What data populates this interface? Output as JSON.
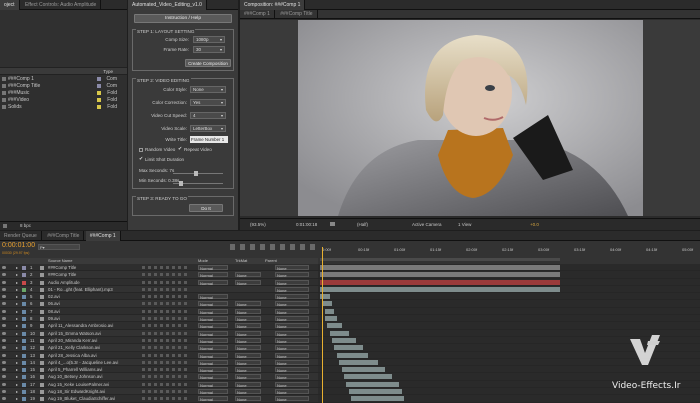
{
  "project_panel": {
    "tabs": [
      "oject",
      "Effect Controls: Audio Amplitude"
    ],
    "column_type": "Type",
    "items": [
      {
        "name": "###Comp 1",
        "color": "#8a8aa8",
        "type": "Com"
      },
      {
        "name": "###Comp Title",
        "color": "#8a8aa8",
        "type": "Com"
      },
      {
        "name": "###Music",
        "color": "#d9c84a",
        "type": "Fold"
      },
      {
        "name": "###Video",
        "color": "#d9c84a",
        "type": "Fold"
      },
      {
        "name": "Solids",
        "color": "#d9c84a",
        "type": "Fold"
      }
    ],
    "footer_text": "8 bpc"
  },
  "script_panel": {
    "tab": "Automated_Video_Editing_v1.0",
    "instruction_button": "Instruction / Help",
    "step1": {
      "title": "STEP 1: LAYOUT SETTING",
      "comp_size_label": "Comp Size:",
      "comp_size_value": "1080p",
      "frame_rate_label": "Frame Rate:",
      "frame_rate_value": "30",
      "create_button": "Create Composition"
    },
    "step2": {
      "title": "STEP 2: VIDEO EDITING",
      "color_style_label": "Color Style:",
      "color_style_value": "None",
      "color_correction_label": "Color Correction:",
      "color_correction_value": "Yes",
      "cut_speed_label": "Video Cut Speed:",
      "cut_speed_value": "4",
      "video_scale_label": "Video Scale:",
      "video_scale_value": "LetterBox",
      "write_title_label": "Write Title:",
      "write_title_value": "Frame Number 1",
      "random_video_label": "Random Video",
      "repeat_video_label": "Repeat Video",
      "limit_shot_label": "Limit Shot Duration",
      "max_seconds_label": "Max Seconds: 7s",
      "max_seconds_fraction": 0.45,
      "min_seconds_label": "Min Seconds: 0.38s",
      "min_seconds_fraction": 0.12
    },
    "step3": {
      "title": "STEP 3: READY TO GO",
      "do_it_button": "Do It"
    }
  },
  "composition_panel": {
    "tab": "Composition: ###Comp 1",
    "subtabs": [
      "###Comp 1",
      "###Comp Title"
    ],
    "footer": {
      "zoom": "(93.5%)",
      "timecode": "0:01:00:18",
      "resolution": "(Half)",
      "camera": "Active Camera",
      "view": "1 View",
      "exposure": "+0.0"
    }
  },
  "timeline": {
    "tabs": [
      "Render Queue",
      "###Comp Title",
      "###Comp 1"
    ],
    "timecode": "0:00:01:00",
    "timecode_sub": "00030 (29.97 fps)",
    "search_placeholder": "P▾",
    "columns": {
      "source_name": "Source Name",
      "mode": "Mode",
      "trkmat": "TrkMat",
      "parent": "Parent"
    },
    "ruler": [
      "0:00f",
      "00:15f",
      "01:00f",
      "01:15f",
      "02:00f",
      "02:15f",
      "03:00f",
      "03:15f",
      "04:00f",
      "04:15f",
      "05:00f"
    ],
    "layers": [
      {
        "num": "1",
        "name": "###Comp Title",
        "color": "#8a8aa8",
        "mode": "Normal",
        "trkmat": "",
        "parent": "None",
        "bar_start": 0,
        "bar_end": 1.0,
        "bar_color": "#7a7a7a"
      },
      {
        "num": "2",
        "name": "###Comp Title",
        "color": "#8a8aa8",
        "mode": "Normal",
        "trkmat": "None",
        "parent": "None",
        "bar_start": 0,
        "bar_end": 1.0,
        "bar_color": "#7a7a7a"
      },
      {
        "num": "3",
        "name": "Audio Amplitude",
        "color": "#c84a4a",
        "mode": "Normal",
        "trkmat": "None",
        "parent": "None",
        "bar_start": 0,
        "bar_end": 1.0,
        "bar_color": "#9a3a3a"
      },
      {
        "num": "4",
        "name": "01 - Ro...ght (feat. Elliphant).mp3",
        "color": "#6aa86a",
        "mode": "",
        "trkmat": "",
        "parent": "None",
        "bar_start": 0,
        "bar_end": 1.0,
        "bar_color": "#7e8c8c"
      },
      {
        "num": "5",
        "name": "02.avi",
        "color": "#6a8aa8",
        "mode": "Normal",
        "trkmat": "",
        "parent": "None",
        "bar_start": 0,
        "bar_end": 0.04,
        "bar_color": "#7e8c8c"
      },
      {
        "num": "6",
        "name": "06.avi",
        "color": "#6a8aa8",
        "mode": "Normal",
        "trkmat": "None",
        "parent": "None",
        "bar_start": 0.01,
        "bar_end": 0.05,
        "bar_color": "#7e8c8c"
      },
      {
        "num": "7",
        "name": "08.avi",
        "color": "#6a8aa8",
        "mode": "Normal",
        "trkmat": "None",
        "parent": "None",
        "bar_start": 0.02,
        "bar_end": 0.06,
        "bar_color": "#7e8c8c"
      },
      {
        "num": "8",
        "name": "09.avi",
        "color": "#6a8aa8",
        "mode": "Normal",
        "trkmat": "None",
        "parent": "None",
        "bar_start": 0.02,
        "bar_end": 0.07,
        "bar_color": "#7e8c8c"
      },
      {
        "num": "9",
        "name": "April 11_Alessandra Ambrosio.avi",
        "color": "#6a8aa8",
        "mode": "Normal",
        "trkmat": "None",
        "parent": "None",
        "bar_start": 0.03,
        "bar_end": 0.09,
        "bar_color": "#7e8c8c"
      },
      {
        "num": "10",
        "name": "April 15_Emma Watson.avi",
        "color": "#6a8aa8",
        "mode": "Normal",
        "trkmat": "None",
        "parent": "None",
        "bar_start": 0.04,
        "bar_end": 0.12,
        "bar_color": "#7e8c8c"
      },
      {
        "num": "11",
        "name": "April 20_Miranda Kerr.avi",
        "color": "#6a8aa8",
        "mode": "Normal",
        "trkmat": "None",
        "parent": "None",
        "bar_start": 0.05,
        "bar_end": 0.15,
        "bar_color": "#7e8c8c"
      },
      {
        "num": "12",
        "name": "April 21_Kelly Clarkson.avi",
        "color": "#6a8aa8",
        "mode": "Normal",
        "trkmat": "None",
        "parent": "None",
        "bar_start": 0.06,
        "bar_end": 0.18,
        "bar_color": "#7e8c8c"
      },
      {
        "num": "13",
        "name": "April 28_Jessica Alba.avi",
        "color": "#6a8aa8",
        "mode": "Normal",
        "trkmat": "None",
        "parent": "None",
        "bar_start": 0.07,
        "bar_end": 0.2,
        "bar_color": "#7e8c8c"
      },
      {
        "num": "14",
        "name": "April 4_...o(5.3r - Jacqueline Lee.avi",
        "color": "#6a8aa8",
        "mode": "Normal",
        "trkmat": "None",
        "parent": "None",
        "bar_start": 0.08,
        "bar_end": 0.24,
        "bar_color": "#7e8c8c"
      },
      {
        "num": "15",
        "name": "April 5_Pharrell Williams.avi",
        "color": "#6a8aa8",
        "mode": "Normal",
        "trkmat": "None",
        "parent": "None",
        "bar_start": 0.09,
        "bar_end": 0.27,
        "bar_color": "#7e8c8c"
      },
      {
        "num": "16",
        "name": "Aug 10_Betsey Johnson.avi",
        "color": "#6a8aa8",
        "mode": "Normal",
        "trkmat": "None",
        "parent": "None",
        "bar_start": 0.1,
        "bar_end": 0.3,
        "bar_color": "#7e8c8c"
      },
      {
        "num": "17",
        "name": "Aug 15_Keke LouisePalmer.avi",
        "color": "#6a8aa8",
        "mode": "Normal",
        "trkmat": "None",
        "parent": "None",
        "bar_start": 0.11,
        "bar_end": 0.33,
        "bar_color": "#7e8c8c"
      },
      {
        "num": "18",
        "name": "Aug 18_Sir EdwardKnight.avi",
        "color": "#6a8aa8",
        "mode": "Normal",
        "trkmat": "None",
        "parent": "None",
        "bar_start": 0.12,
        "bar_end": 0.34,
        "bar_color": "#7e8c8c"
      },
      {
        "num": "19",
        "name": "Aug 19_Bluket_ClaudiaSchiffer.avi",
        "color": "#6a8aa8",
        "mode": "Normal",
        "trkmat": "None",
        "parent": "None",
        "bar_start": 0.13,
        "bar_end": 0.35,
        "bar_color": "#7e8c8c"
      }
    ]
  },
  "watermark": {
    "text": "Video-Effects.Ir"
  }
}
